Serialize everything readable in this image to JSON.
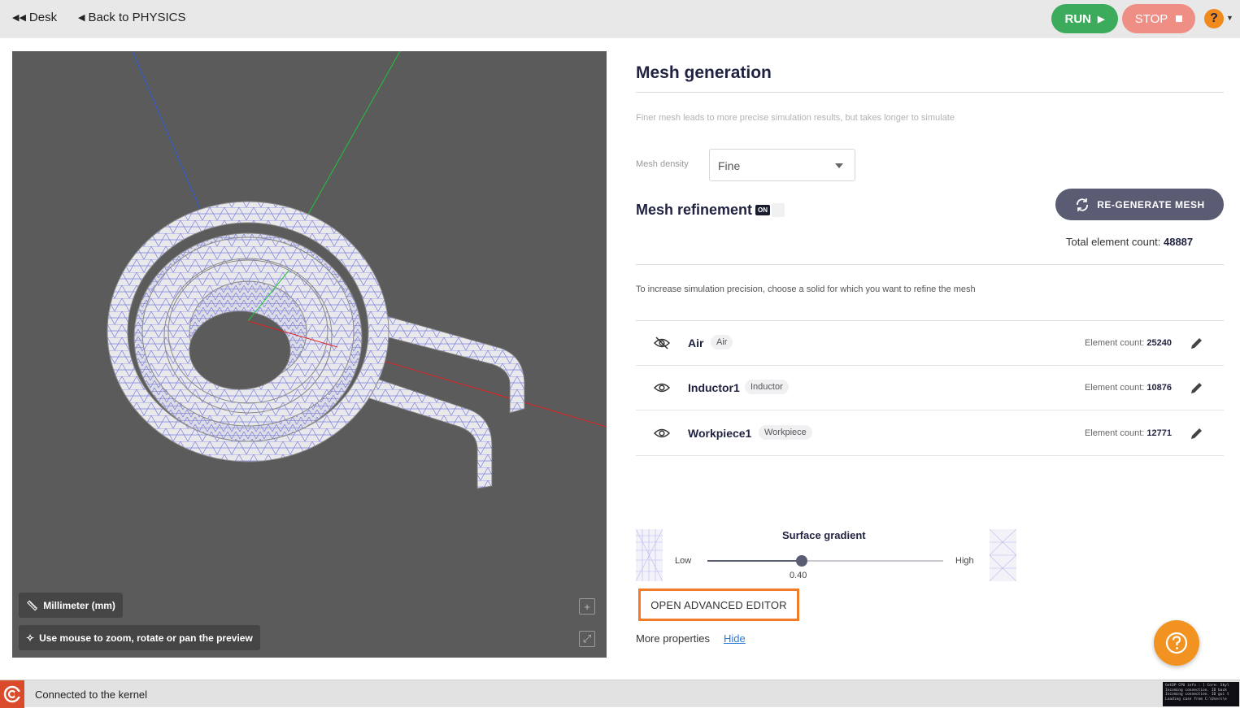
{
  "topbar": {
    "desk_label": "Desk",
    "back_label": "Back to PHYSICS",
    "run_label": "RUN",
    "stop_label": "STOP",
    "help_label": "?"
  },
  "viewport": {
    "units_label": "Millimeter (mm)",
    "hint_label": "Use mouse to zoom, rotate or pan the preview"
  },
  "panel": {
    "title": "Mesh generation",
    "subtitle": "Finer mesh leads to more precise simulation results, but takes longer to simulate",
    "mesh_density_label": "Mesh density",
    "mesh_density_value": "Fine",
    "refinement_title": "Mesh refinement",
    "refinement_toggle": "ON",
    "regen_label": "RE-GENERATE MESH",
    "total_label": "Total element count:",
    "total_value": "48887",
    "refine_hint": "To increase simulation precision, choose a solid for which you want to refine the mesh",
    "element_count_label": "Element count:",
    "solids": [
      {
        "name": "Air",
        "tag": "Air",
        "count": "25240",
        "visible": false
      },
      {
        "name": "Inductor1",
        "tag": "Inductor",
        "count": "10876",
        "visible": true
      },
      {
        "name": "Workpiece1",
        "tag": "Workpiece",
        "count": "12771",
        "visible": true
      }
    ],
    "gradient": {
      "title": "Surface gradient",
      "low_label": "Low",
      "high_label": "High",
      "value": "0.40",
      "fraction": 0.4
    },
    "advanced_label": "OPEN ADVANCED EDITOR",
    "more_label": "More properties",
    "hide_label": "Hide"
  },
  "status": {
    "text": "Connected to the kernel",
    "console_lines": [
      "GetDP CPU info : [ Core: Skyl",
      "Incoming connection. ID back",
      "Incoming connection. ID gui t",
      "Loading case from C:\\Users\\e"
    ]
  },
  "colors": {
    "run": "#3cab5c",
    "stop": "#ee8e85",
    "accent": "#f07b2a",
    "primary": "#5a5c73",
    "viewport_bg": "#5b5b5b",
    "mesh_line": "#7b7fe0"
  }
}
